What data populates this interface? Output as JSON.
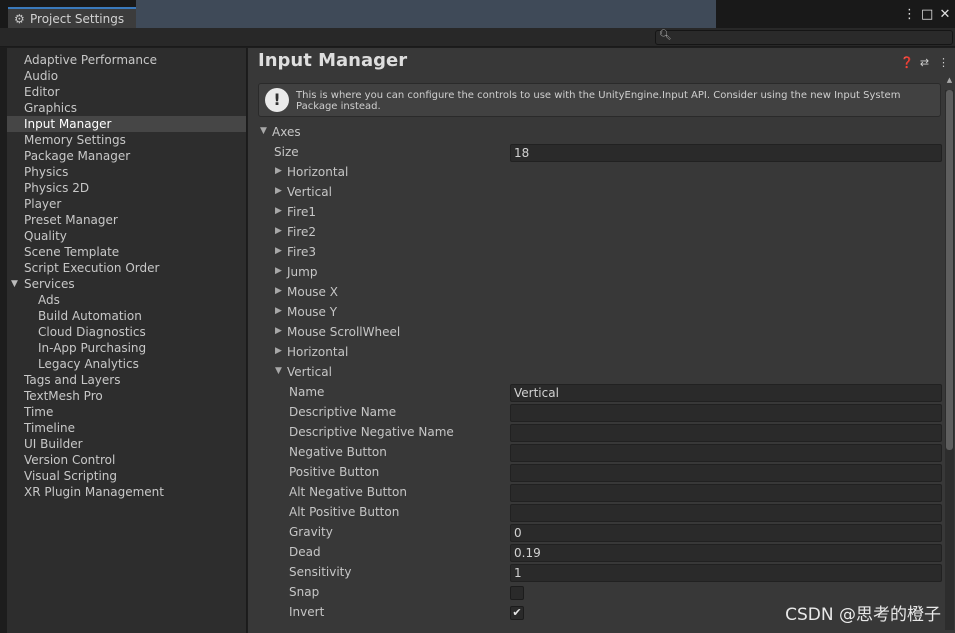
{
  "window": {
    "tab_title": "Project Settings",
    "controls": [
      "⋮",
      "□",
      "✕"
    ]
  },
  "search": {
    "placeholder": "",
    "icon": "search-icon"
  },
  "sidebar": {
    "items": [
      {
        "label": "Adaptive Performance"
      },
      {
        "label": "Audio"
      },
      {
        "label": "Editor"
      },
      {
        "label": "Graphics"
      },
      {
        "label": "Input Manager",
        "selected": true
      },
      {
        "label": "Memory Settings"
      },
      {
        "label": "Package Manager"
      },
      {
        "label": "Physics"
      },
      {
        "label": "Physics 2D"
      },
      {
        "label": "Player"
      },
      {
        "label": "Preset Manager"
      },
      {
        "label": "Quality"
      },
      {
        "label": "Scene Template"
      },
      {
        "label": "Script Execution Order"
      },
      {
        "label": "Services",
        "expanded": true
      },
      {
        "label": "Ads",
        "sub": true
      },
      {
        "label": "Build Automation",
        "sub": true
      },
      {
        "label": "Cloud Diagnostics",
        "sub": true
      },
      {
        "label": "In-App Purchasing",
        "sub": true
      },
      {
        "label": "Legacy Analytics",
        "sub": true
      },
      {
        "label": "Tags and Layers"
      },
      {
        "label": "TextMesh Pro"
      },
      {
        "label": "Time"
      },
      {
        "label": "Timeline"
      },
      {
        "label": "UI Builder"
      },
      {
        "label": "Version Control"
      },
      {
        "label": "Visual Scripting"
      },
      {
        "label": "XR Plugin Management"
      }
    ]
  },
  "main": {
    "title": "Input Manager",
    "info": "This is where you can configure the controls to use with the UnityEngine.Input API. Consider using the new Input System Package instead.",
    "axes_label": "Axes",
    "size_label": "Size",
    "size_value": "18",
    "axes": [
      "Horizontal",
      "Vertical",
      "Fire1",
      "Fire2",
      "Fire3",
      "Jump",
      "Mouse X",
      "Mouse Y",
      "Mouse ScrollWheel",
      "Horizontal"
    ],
    "expanded_axis": "Vertical",
    "props": [
      {
        "label": "Name",
        "value": "Vertical",
        "type": "text"
      },
      {
        "label": "Descriptive Name",
        "value": "",
        "type": "text"
      },
      {
        "label": "Descriptive Negative Name",
        "value": "",
        "type": "text"
      },
      {
        "label": "Negative Button",
        "value": "",
        "type": "text"
      },
      {
        "label": "Positive Button",
        "value": "",
        "type": "text"
      },
      {
        "label": "Alt Negative Button",
        "value": "",
        "type": "text"
      },
      {
        "label": "Alt Positive Button",
        "value": "",
        "type": "text"
      },
      {
        "label": "Gravity",
        "value": "0",
        "type": "text"
      },
      {
        "label": "Dead",
        "value": "0.19",
        "type": "text"
      },
      {
        "label": "Sensitivity",
        "value": "1",
        "type": "text"
      },
      {
        "label": "Snap",
        "value": "",
        "type": "check",
        "checked": false
      },
      {
        "label": "Invert",
        "value": "",
        "type": "check",
        "checked": true
      }
    ]
  },
  "watermark": "CSDN @思考的橙子"
}
